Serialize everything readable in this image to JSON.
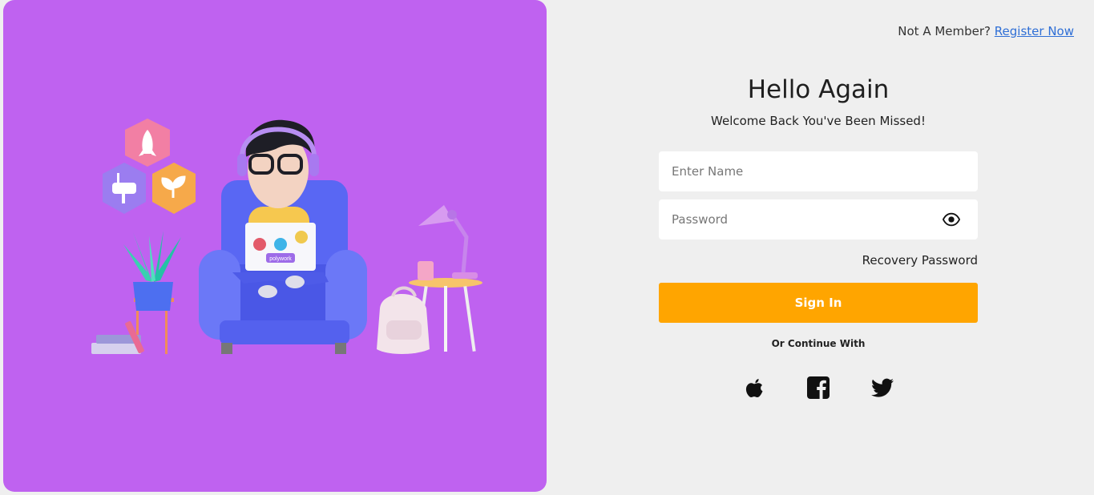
{
  "header": {
    "prompt": "Not A Member?",
    "register_link": "Register Now"
  },
  "login": {
    "title": "Hello Again",
    "subtitle": "Welcome Back You've Been Missed!",
    "name_placeholder": "Enter Name",
    "password_placeholder": "Password",
    "recovery": "Recovery Password",
    "signin": "Sign In",
    "continue_with": "Or Continue With"
  },
  "illustration": {
    "laptop_sticker": "polywork"
  },
  "social": [
    "apple-icon",
    "facebook-icon",
    "twitter-icon"
  ],
  "colors": {
    "left_panel": "#bf62f0",
    "page_bg": "#efefef",
    "accent": "#ffa500",
    "link": "#2f6fd6"
  }
}
